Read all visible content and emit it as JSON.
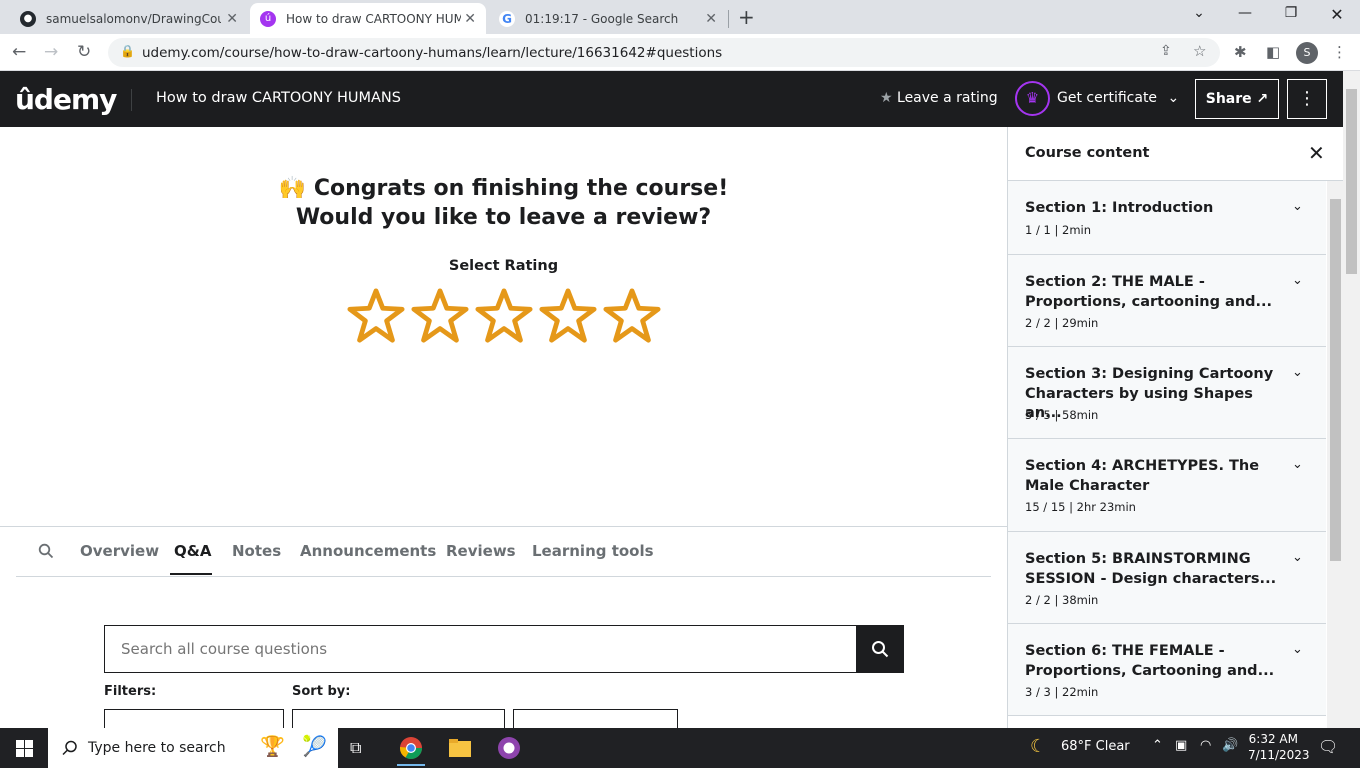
{
  "browser": {
    "tabs": [
      {
        "title": "samuelsalomonv/DrawingCourse",
        "close": "✕"
      },
      {
        "title": "How to draw CARTOONY HUMAN",
        "close": "✕"
      },
      {
        "title": "01:19:17 - Google Search",
        "close": "✕"
      }
    ],
    "new_tab": "+",
    "url": "udemy.com/course/how-to-draw-cartoony-humans/learn/lecture/16631642#questions",
    "profile_initial": "S"
  },
  "header": {
    "logo": "ûdemy",
    "course_title": "How to draw CARTOONY HUMANS",
    "leave_rating": "Leave a rating",
    "get_certificate": "Get certificate",
    "share": "Share"
  },
  "review": {
    "emoji": "🙌",
    "line1": "Congrats on finishing the course!",
    "line2": "Would you like to leave a review?",
    "select_rating": "Select Rating",
    "star_count": 5,
    "star_color": "#e59819"
  },
  "tabs": [
    "Overview",
    "Q&A",
    "Notes",
    "Announcements",
    "Reviews",
    "Learning tools"
  ],
  "active_tab": "Q&A",
  "qa": {
    "search_placeholder": "Search all course questions",
    "filters_label": "Filters:",
    "sort_label": "Sort by:"
  },
  "sidebar": {
    "title": "Course content",
    "sections": [
      {
        "title": "Section 1: Introduction",
        "meta": "1 / 1 | 2min"
      },
      {
        "title": "Section 2: THE MALE - Proportions, cartooning and...",
        "meta": "2 / 2 | 29min"
      },
      {
        "title": "Section 3: Designing Cartoony Characters by using Shapes an...",
        "meta": "5 / 5 | 58min"
      },
      {
        "title": "Section 4: ARCHETYPES. The Male Character",
        "meta": "15 / 15 | 2hr 23min"
      },
      {
        "title": "Section 5: BRAINSTORMING SESSION - Design characters...",
        "meta": "2 / 2 | 38min"
      },
      {
        "title": "Section 6: THE FEMALE - Proportions, Cartooning and...",
        "meta": "3 / 3 | 22min"
      }
    ]
  },
  "taskbar": {
    "search_placeholder": "Type here to search",
    "weather": "68°F  Clear",
    "time": "6:32 AM",
    "date": "7/11/2023"
  },
  "colors": {
    "accent_purple": "#a435f0",
    "header_dark": "#1c1d1f",
    "star_gold": "#e59819"
  }
}
